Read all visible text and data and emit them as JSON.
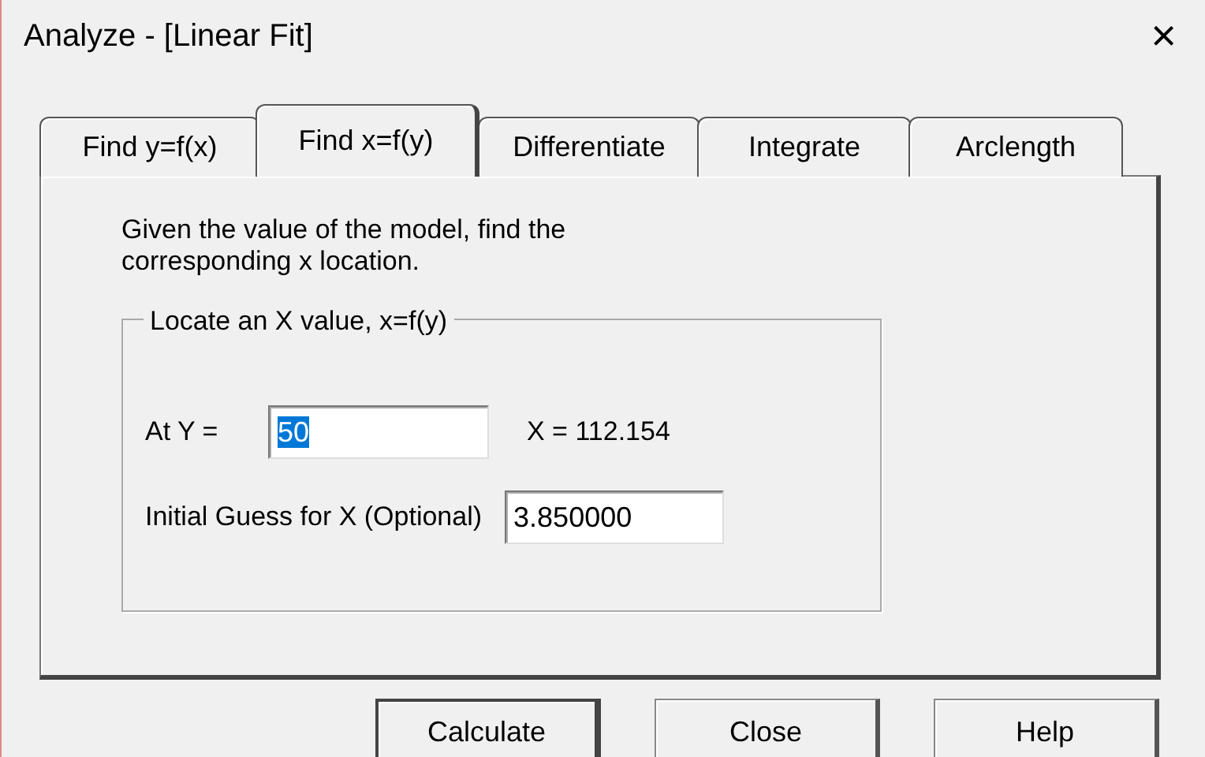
{
  "window": {
    "title": "Analyze - [Linear Fit]",
    "close": "×"
  },
  "tabs": [
    {
      "label": "Find y=f(x)",
      "selected": false
    },
    {
      "label": "Find x=f(y)",
      "selected": true
    },
    {
      "label": "Differentiate",
      "selected": false
    },
    {
      "label": "Integrate",
      "selected": false
    },
    {
      "label": "Arclength",
      "selected": false
    }
  ],
  "description": "Given the value of the model, find the corresponding x location.",
  "group": {
    "title": "Locate an X value, x=f(y)",
    "at_y": {
      "label": "At Y =",
      "value": "50",
      "text_selected": true
    },
    "result": "X = 112.154",
    "guess": {
      "label": "Initial Guess for X (Optional)",
      "value": "3.850000",
      "text_selected": false
    }
  },
  "buttons": [
    {
      "label": "Calculate",
      "default": true
    },
    {
      "label": "Close",
      "default": false
    },
    {
      "label": "Help",
      "default": false
    }
  ]
}
